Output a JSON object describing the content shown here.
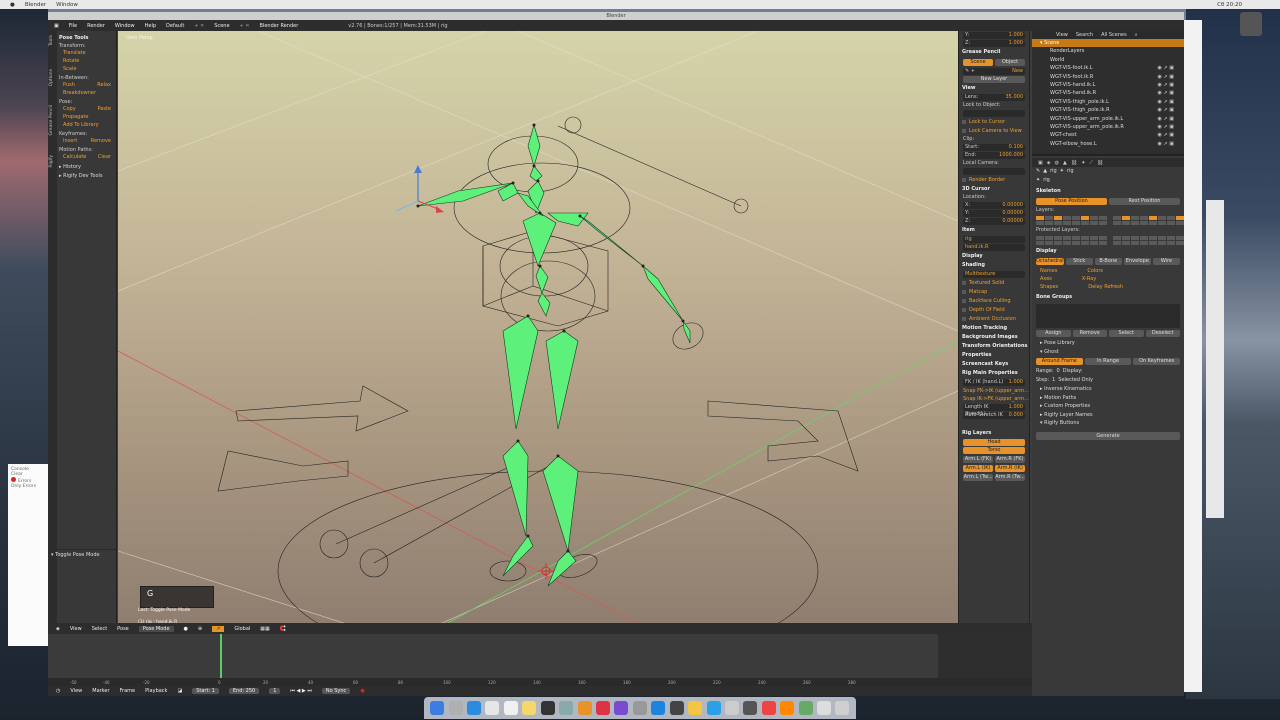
{
  "mac": {
    "app": "Blender",
    "window_menu": "Window",
    "clock": "Сб 20:20"
  },
  "console": {
    "title": "Console",
    "line1": "Clear",
    "line2": "Errors",
    "line3": "Only Errors",
    "error": "Error"
  },
  "blender": {
    "title": "Blender",
    "menu": {
      "file": "File",
      "render": "Render",
      "window": "Window",
      "help": "Help",
      "layout": "Default",
      "scene": "Scene",
      "engine": "Blender Render",
      "stats": "v2.76 | Bones:1/257 | Mem:31.53M | rig"
    },
    "toolshelf": {
      "tabs": [
        "Tools",
        "Options",
        "Grease Pencil",
        "Rigify"
      ],
      "pose_tools": "Pose Tools",
      "transform": "Transform:",
      "translate": "Translate",
      "rotate": "Rotate",
      "scale": "Scale",
      "in_between": "In-Between:",
      "push": "Push",
      "relax": "Relax",
      "breakdowner": "Breakdowner",
      "pose": "Pose:",
      "copy": "Copy",
      "paste": "Paste",
      "propagate": "Propagate",
      "add_to_library": "Add To Library",
      "keyframes": "Keyframes:",
      "insert": "Insert",
      "remove": "Remove",
      "motion_paths": "Motion Paths:",
      "calculate": "Calculate",
      "clear": "Clear",
      "history": "History",
      "rigify_dev": "Rigify Dev Tools",
      "last_op": "Toggle Pose Mode"
    },
    "viewport": {
      "label": "User Persp",
      "key": "G",
      "last_key": "Last: Toggle Pose Mode",
      "info": "(1) rig : hand.ik.R"
    },
    "npanel": {
      "y_label": "Y:",
      "y_val": "1.000",
      "z_label": "Z:",
      "z_val": "1.000",
      "grease_pencil": "Grease Pencil",
      "scene": "Scene",
      "object": "Object",
      "new": "New",
      "new_layer": "New Layer",
      "view": "View",
      "lens": "Lens:",
      "lens_val": "35.000",
      "lock_to_object": "Lock to Object:",
      "lock_to_cursor": "Lock to Cursor",
      "lock_camera": "Lock Camera to View",
      "clip": "Clip:",
      "start": "Start:",
      "start_val": "0.100",
      "end": "End:",
      "end_val": "1000.000",
      "local_camera": "Local Camera:",
      "render_border": "Render Border",
      "cursor_3d": "3D Cursor",
      "location": "Location:",
      "cx": "X:",
      "cx_val": "0.00000",
      "cy": "Y:",
      "cy_val": "0.00000",
      "cz": "Z:",
      "cz_val": "0.00000",
      "item": "Item",
      "item_obj": "rig",
      "item_bone": "hand.ik.R",
      "display": "Display",
      "shading": "Shading",
      "multitexture": "Multitexture",
      "textured_solid": "Textured Solid",
      "matcap": "Matcap",
      "backface": "Backface Culling",
      "dof": "Depth Of Field",
      "ao": "Ambient Occlusion",
      "motion_tracking": "Motion Tracking",
      "background_images": "Background Images",
      "transform_orient": "Transform Orientations",
      "properties": "Properties",
      "screencast": "Screencast Keys",
      "rig_main": "Rig Main Properties",
      "fk_ik": "FK / IK (hand.L)",
      "fk_ik_val": "1.000",
      "snap_fk_ik": "Snap FK->IK (upper_arm...",
      "snap_ik_fk": "Snap IK->FK (upper_arm...",
      "length_ik": "Length IK (hand.L)",
      "length_ik_val": "1.000",
      "auto_stretch": "Auto-Stretch IK",
      "auto_stretch_val": "0.000",
      "rig_layers": "Rig Layers",
      "head": "Head",
      "torso": "Torso",
      "arm_l_fk": "Arm.L (FK)",
      "arm_r_fk": "Arm.R (FK)",
      "arm_l_ik": "Arm.L (IK)",
      "arm_r_ik": "Arm.R (IK)",
      "arm_l_tw": "Arm.L (Tw...",
      "arm_r_tw": "Arm.R (Tw..."
    },
    "outliner": {
      "view": "View",
      "search": "Search",
      "scenes": "All Scenes",
      "rows": [
        "Scene",
        "RenderLayers",
        "World",
        "WGT-VIS-foot.ik.L",
        "WGT-VIS-foot.ik.R",
        "WGT-VIS-hand.ik.L",
        "WGT-VIS-hand.ik.R",
        "WGT-VIS-thigh_pole.ik.L",
        "WGT-VIS-thigh_pole.ik.R",
        "WGT-VIS-upper_arm_pole.ik.L",
        "WGT-VIS-upper_arm_pole.ik.R",
        "WGT-chest",
        "WGT-elbow_hose.L"
      ]
    },
    "props": {
      "rig": "rig",
      "rig2": "rig",
      "skeleton": "Skeleton",
      "pose_position": "Pose Position",
      "rest_position": "Rest Position",
      "layers": "Layers:",
      "protected": "Protected Layers:",
      "display": "Display",
      "octahedral": "Octahedral",
      "stick": "Stick",
      "bbone": "B-Bone",
      "envelope": "Envelope",
      "wire": "Wire",
      "names": "Names",
      "colors": "Colors",
      "axes": "Axes",
      "xray": "X-Ray",
      "shapes": "Shapes",
      "delay": "Delay Refresh",
      "bone_groups": "Bone Groups",
      "assign": "Assign",
      "remove": "Remove",
      "select": "Select",
      "deselect": "Deselect",
      "pose_library": "Pose Library",
      "ghost": "Ghost",
      "around_frame": "Around Frame",
      "in_range": "In Range",
      "on_keyframes": "On Keyframes",
      "range": "Range:",
      "range_val": "0",
      "display2": "Display:",
      "step": "Step:",
      "step_val": "1",
      "selected_only": "Selected Only",
      "ik": "Inverse Kinematics",
      "motion_paths": "Motion Paths",
      "custom_props": "Custom Properties",
      "rigify_layers": "Rigify Layer Names",
      "rigify_buttons": "Rigify Buttons",
      "generate": "Generate"
    },
    "header3d": {
      "view": "View",
      "select": "Select",
      "pose": "Pose",
      "mode": "Pose Mode",
      "orient": "Global"
    },
    "timeline": {
      "ruler": [
        "-50",
        "-40",
        "-20",
        "0",
        "20",
        "40",
        "60",
        "80",
        "100",
        "120",
        "140",
        "160",
        "180",
        "200",
        "220",
        "240",
        "260",
        "280"
      ],
      "view": "View",
      "marker": "Marker",
      "frame": "Frame",
      "playback": "Playback",
      "start": "Start:",
      "start_val": "1",
      "end": "End:",
      "end_val": "250",
      "current": "1",
      "sync": "No Sync"
    }
  }
}
